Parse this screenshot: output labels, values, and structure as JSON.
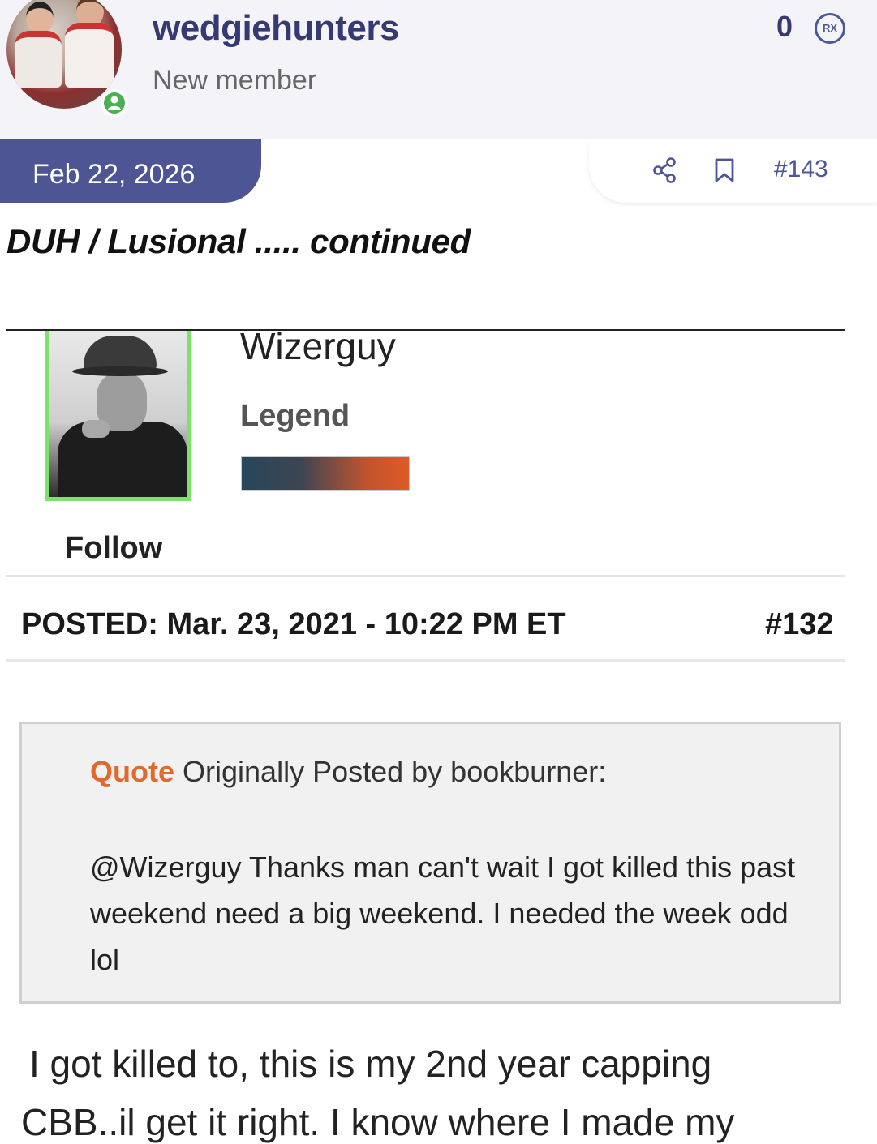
{
  "header": {
    "username": "wedgiehunters",
    "member_role": "New member",
    "points": "0",
    "badge_label": "RX",
    "status": "online"
  },
  "post": {
    "date": "Feb 22, 2026",
    "number": "#143",
    "title": "DUH / Lusional ..... continued",
    "actions": [
      "share-icon",
      "bookmark-icon"
    ]
  },
  "embedded": {
    "author_name": "Wizerguy",
    "author_rank": "Legend",
    "follow_label": "Follow",
    "posted_line": "POSTED: Mar. 23, 2021 - 10:22 PM ET",
    "post_number": "#132",
    "quote_label": "Quote",
    "quote_attribution": "Originally Posted by bookburner:",
    "quote_body": "@Wizerguy  Thanks man can't wait I got killed this past weekend need a big weekend.  I needed the week odd lol",
    "reply_line1": "I got killed to, this is my 2nd year capping",
    "reply_line2": "CBB..il get it right. I know where I made my"
  },
  "colors": {
    "brand": "#353a72",
    "date_tab": "#4e5594",
    "online": "#4caf50",
    "quote_accent": "#e06a2e",
    "avatar_border": "#7be36a"
  }
}
